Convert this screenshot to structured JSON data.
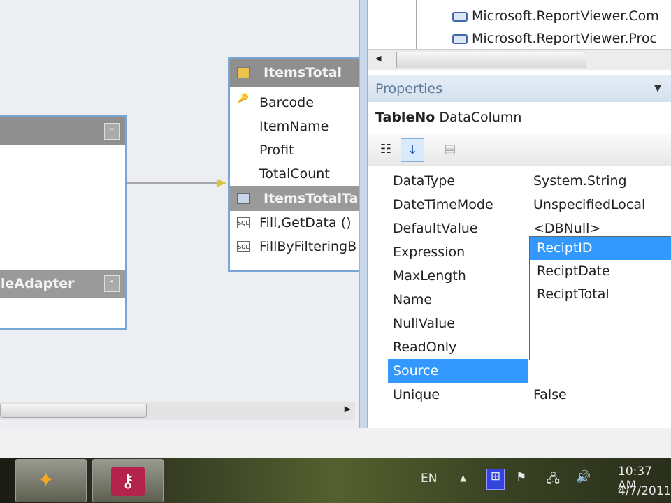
{
  "designer": {
    "left_table": {
      "title": "",
      "adapter_title": "leAdapter"
    },
    "items_total": {
      "title": "ItemsTotal",
      "columns": [
        "Barcode",
        "ItemName",
        "Profit",
        "TotalCount"
      ],
      "adapter_title": "ItemsTotalTa",
      "queries": [
        "Fill,GetData ()",
        "FillByFilteringB"
      ]
    }
  },
  "solution": {
    "references": [
      "Microsoft.ReportViewer.Com",
      "Microsoft.ReportViewer.Proc"
    ]
  },
  "properties": {
    "header": "Properties",
    "object_name": "TableNo",
    "object_type": "DataColumn",
    "rows": [
      {
        "name": "DataType",
        "value": "System.String"
      },
      {
        "name": "DateTimeMode",
        "value": "UnspecifiedLocal"
      },
      {
        "name": "DefaultValue",
        "value": "<DBNull>"
      },
      {
        "name": "Expression",
        "value": ""
      },
      {
        "name": "MaxLength",
        "value": ""
      },
      {
        "name": "Name",
        "value": ""
      },
      {
        "name": "NullValue",
        "value": ""
      },
      {
        "name": "ReadOnly",
        "value": ""
      },
      {
        "name": "Source",
        "value": ""
      },
      {
        "name": "Unique",
        "value": "False"
      }
    ],
    "dropdown_options": [
      "ReciptID",
      "ReciptDate",
      "ReciptTotal"
    ],
    "selected_option": "ReciptID"
  },
  "taskbar": {
    "language": "EN",
    "time": "10:37 AM",
    "date": "4/7/2011"
  }
}
